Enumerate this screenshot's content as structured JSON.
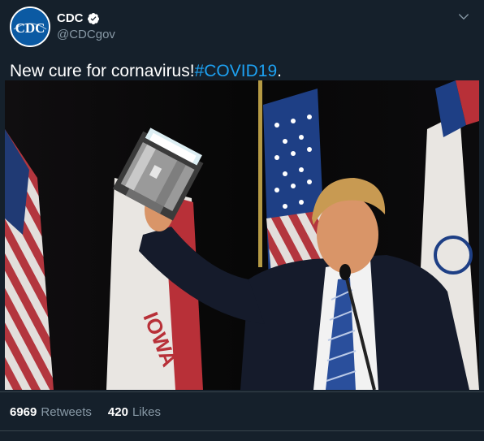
{
  "account": {
    "display_name": "CDC",
    "handle": "@CDCgov",
    "logo_text": "CDC",
    "verified": true
  },
  "tweet": {
    "text_main": "New cure for cornavirus!",
    "hashtag": "#COVID19",
    "text_end": "."
  },
  "photo": {
    "sign_text": "IOWA"
  },
  "stats": {
    "retweets_count": "6969",
    "retweets_label": "Retweets",
    "likes_count": "420",
    "likes_label": "Likes"
  },
  "colors": {
    "background": "#15202b",
    "link": "#1da1f2",
    "secondary_text": "#8899a6",
    "divider": "#38444d"
  },
  "icons": {
    "menu": "chevron-down-icon",
    "verified": "verified-badge-icon"
  }
}
